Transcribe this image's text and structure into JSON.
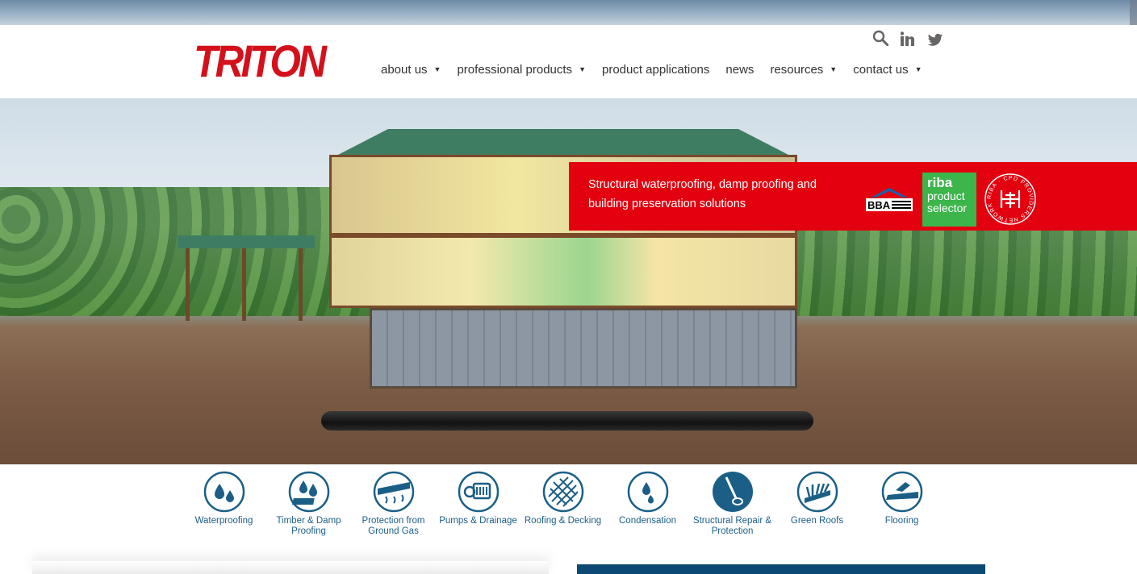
{
  "brand": {
    "logo_text": "TRITON",
    "accent_color": "#d4111b"
  },
  "header": {
    "social": [
      "search-icon",
      "linkedin-icon",
      "twitter-icon"
    ],
    "nav": [
      {
        "label": "about us",
        "has_dropdown": true
      },
      {
        "label": "professional products",
        "has_dropdown": true
      },
      {
        "label": "product applications",
        "has_dropdown": false
      },
      {
        "label": "news",
        "has_dropdown": false
      },
      {
        "label": "resources",
        "has_dropdown": true
      },
      {
        "label": "contact us",
        "has_dropdown": true
      }
    ],
    "caret_glyph": "▼"
  },
  "hero": {
    "banner_text": "Structural waterproofing, damp proofing and building preservation solutions",
    "banner_color": "#e3000f",
    "badges": {
      "bba": "BBA",
      "riba_line1": "riba",
      "riba_line2": "product selector",
      "cpd_ring": "RIBA · CPD PROVIDERS NETWORK ·"
    }
  },
  "categories": [
    {
      "label": "Waterproofing",
      "icon": "water-drops-icon"
    },
    {
      "label": "Timber & Damp Proofing",
      "icon": "timber-damp-icon"
    },
    {
      "label": "Protection from Ground Gas",
      "icon": "ground-gas-icon"
    },
    {
      "label": "Pumps & Drainage",
      "icon": "pump-icon"
    },
    {
      "label": "Roofing & Decking",
      "icon": "roof-tiles-icon"
    },
    {
      "label": "Condensation",
      "icon": "condensation-icon"
    },
    {
      "label": "Structural Repair & Protection",
      "icon": "structural-repair-icon"
    },
    {
      "label": "Green Roofs",
      "icon": "green-roof-icon"
    },
    {
      "label": "Flooring",
      "icon": "flooring-icon"
    }
  ],
  "colors": {
    "category_blue": "#1b5f86",
    "footer_blue": "#0d4a73"
  }
}
